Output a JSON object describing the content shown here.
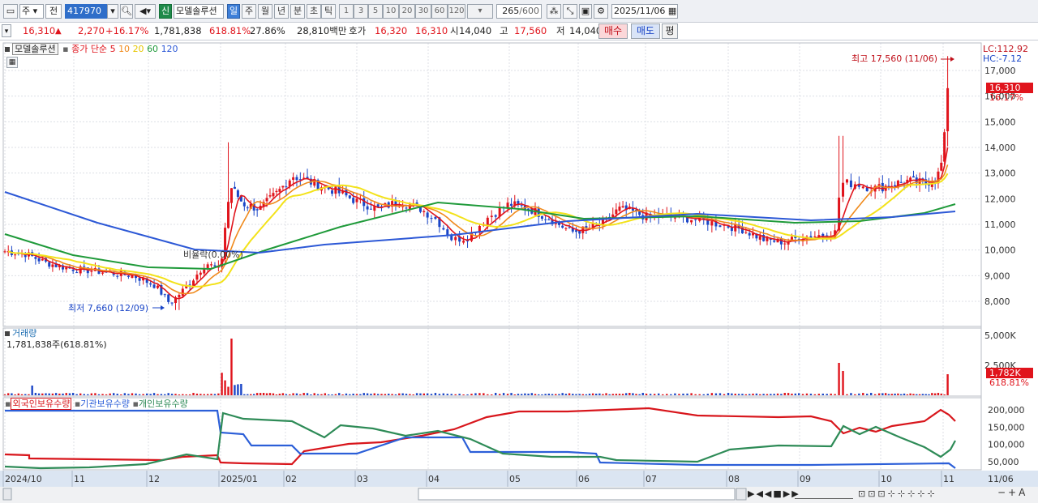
{
  "toolbar": {
    "market": "주",
    "range_option": "전",
    "stock_code": "417970",
    "new_badge": "신",
    "stock_name": "모델솔루션",
    "periods": [
      "일",
      "주",
      "월",
      "년",
      "분",
      "초",
      "틱"
    ],
    "active_period": "일",
    "minute_options": [
      "1",
      "3",
      "5",
      "10",
      "20",
      "30",
      "60",
      "120"
    ],
    "bar_count": "265",
    "bar_total": "/600",
    "date": "2025/11/06"
  },
  "quote": {
    "price": "16,310",
    "change_arrow": "▲",
    "change": "2,270",
    "change_pct": "+16.17%",
    "volume": "1,781,838",
    "volume_ratio": "618.81%",
    "turnover": "27.86%",
    "amount": "28,810백만",
    "ask_label": "호가",
    "ask": "16,320",
    "bid": "16,310",
    "open_label": "시",
    "open": "14,040",
    "high_label": "고",
    "high": "17,560",
    "low_label": "저",
    "low": "14,040",
    "buy_button": "매수",
    "sell_button": "매도",
    "eval_button": "평"
  },
  "price_panel": {
    "name_label": "모델솔루션",
    "ma_label": "종가 단순",
    "ma_periods": [
      "5",
      "10",
      "20",
      "60",
      "120"
    ],
    "lc_label": "LC:112.92",
    "hc_label": "HC:-7.12",
    "high_annotation": "최고 17,560 (11/06)",
    "low_annotation": "최저 7,660 (12/09)",
    "event_label": "비율락(0.00%)",
    "current_price_tag": "16,310",
    "current_pct_tag": "16.17%",
    "y_ticks": [
      "17,000",
      "16,000",
      "15,000",
      "14,000",
      "13,000",
      "12,000",
      "11,000",
      "10,000",
      "9,000",
      "8,000"
    ]
  },
  "volume_panel": {
    "title": "거래량",
    "value_label": "1,781,838주(618.81%)",
    "y_ticks": [
      "5,000K",
      "2,500K"
    ],
    "current_tag": "1,782K",
    "current_pct": "618.81%"
  },
  "holding_panel": {
    "series_labels": [
      "외국인보유수량",
      "기관보유수량",
      "개인보유수량"
    ],
    "y_ticks": [
      "200,000",
      "150,000",
      "100,000",
      "50,000"
    ]
  },
  "x_axis": {
    "labels": [
      "2024/10",
      "11",
      "12",
      "2025/01",
      "02",
      "03",
      "04",
      "05",
      "06",
      "07",
      "08",
      "09",
      "10",
      "11",
      "11/06"
    ]
  },
  "colors": {
    "up": "#e0141c",
    "down": "#1b46c7",
    "ma5": "#e0141c",
    "ma10": "#f08a1c",
    "ma20": "#f3e21a",
    "ma60": "#1f9a3a",
    "ma120": "#2c58d6",
    "foreign": "#d8161c",
    "institution": "#2c5fd8",
    "individual": "#2e8b57"
  },
  "chart_data": {
    "type": "candlestick",
    "price_range": [
      7660,
      17560
    ],
    "price_key_points": [
      {
        "date": "2024/10",
        "close": 9950
      },
      {
        "date": "12/09",
        "low": 7660
      },
      {
        "date": "2025/01",
        "close": 9200
      },
      {
        "date": "2025/01",
        "high": 14200
      },
      {
        "date": "02",
        "close": 12600
      },
      {
        "date": "03",
        "close": 11900
      },
      {
        "date": "04",
        "close": 10200
      },
      {
        "date": "05",
        "close": 11800
      },
      {
        "date": "06",
        "close": 10800
      },
      {
        "date": "07",
        "close": 11400
      },
      {
        "date": "08",
        "close": 10500
      },
      {
        "date": "09",
        "close": 10500
      },
      {
        "date": "09",
        "high": 14450
      },
      {
        "date": "10",
        "close": 12500
      },
      {
        "date": "11/06",
        "high": 17560,
        "close": 16310
      }
    ],
    "volume_peak": {
      "date": "2025/01",
      "value": 5000000
    },
    "volume_last": 1781838,
    "holdings": {
      "foreign": [
        {
          "date": "2024/10",
          "value": 70000
        },
        {
          "date": "2025/01",
          "value": 60000
        },
        {
          "date": "04",
          "value": 120000
        },
        {
          "date": "05",
          "value": 195000
        },
        {
          "date": "09",
          "value": 180000
        },
        {
          "date": "11/06",
          "value": 170000
        }
      ],
      "institution": [
        {
          "date": "2024/10",
          "value": 200000
        },
        {
          "date": "2025/01",
          "value": 130000
        },
        {
          "date": "02",
          "value": 85000
        },
        {
          "date": "04",
          "value": 120000
        },
        {
          "date": "05",
          "value": 80000
        },
        {
          "date": "06",
          "value": 45000
        },
        {
          "date": "11/06",
          "value": 45000
        }
      ],
      "individual": [
        {
          "date": "2024/10",
          "value": 35000
        },
        {
          "date": "2025/01",
          "value": 200000
        },
        {
          "date": "04",
          "value": 130000
        },
        {
          "date": "05",
          "value": 70000
        },
        {
          "date": "09",
          "value": 100000
        },
        {
          "date": "10",
          "value": 130000
        },
        {
          "date": "11/06",
          "value": 110000
        }
      ]
    }
  }
}
